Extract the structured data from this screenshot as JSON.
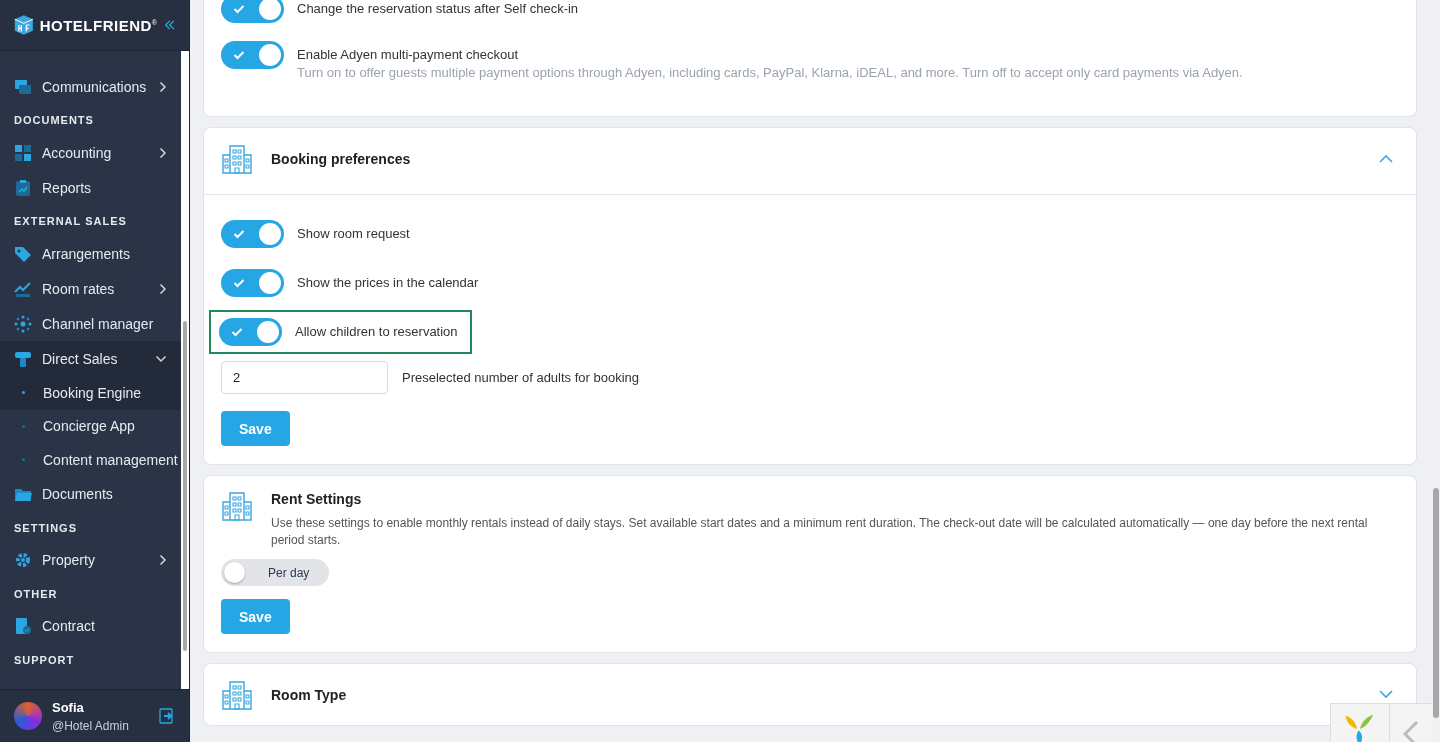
{
  "sidebar": {
    "brand": "HOTELFRIEND",
    "brand_mark": "®",
    "items": [
      {
        "kind": "item",
        "label": "Communications",
        "has_submenu": true,
        "expanded": false,
        "selected": false
      },
      {
        "kind": "heading",
        "label": "DOCUMENTS"
      },
      {
        "kind": "item",
        "label": "Accounting",
        "has_submenu": true,
        "expanded": false,
        "selected": false
      },
      {
        "kind": "item",
        "label": "Reports",
        "has_submenu": false,
        "selected": false
      },
      {
        "kind": "heading",
        "label": "EXTERNAL SALES"
      },
      {
        "kind": "item",
        "label": "Arrangements",
        "has_submenu": false,
        "selected": false
      },
      {
        "kind": "item",
        "label": "Room rates",
        "has_submenu": true,
        "expanded": false,
        "selected": false
      },
      {
        "kind": "item",
        "label": "Channel manager",
        "has_submenu": false,
        "selected": false
      },
      {
        "kind": "item",
        "label": "Direct Sales",
        "has_submenu": true,
        "expanded": true,
        "selected": false,
        "children": [
          {
            "label": "Booking Engine",
            "selected": true
          },
          {
            "label": "Concierge App",
            "selected": false
          },
          {
            "label": "Content management",
            "selected": false
          }
        ]
      },
      {
        "kind": "item",
        "label": "Documents",
        "has_submenu": false,
        "selected": false
      },
      {
        "kind": "heading",
        "label": "SETTINGS"
      },
      {
        "kind": "item",
        "label": "Property",
        "has_submenu": true,
        "expanded": false,
        "selected": false
      },
      {
        "kind": "heading",
        "label": "OTHER"
      },
      {
        "kind": "item",
        "label": "Contract",
        "has_submenu": false,
        "selected": false
      },
      {
        "kind": "heading",
        "label": "SUPPORT"
      }
    ],
    "user": {
      "name": "Sofia",
      "role": "@Hotel Admin"
    }
  },
  "cards": [
    {
      "kind": "toggles",
      "toggles": [
        {
          "label": "Change the reservation status after Self check-in",
          "on": true,
          "highlighted": false
        },
        {
          "label": "Enable Adyen multi-payment checkout",
          "description": "Turn on to offer guests multiple payment options through Adyen, including cards, PayPal, Klarna, iDEAL, and more. Turn off to accept only card payments via Adyen.",
          "on": true,
          "highlighted": false
        }
      ]
    },
    {
      "kind": "section",
      "title": "Booking preferences",
      "expanded": true,
      "toggles": [
        {
          "label": "Show room request",
          "on": true,
          "highlighted": false
        },
        {
          "label": "Show the prices in the calendar",
          "on": true,
          "highlighted": false
        },
        {
          "label": "Allow children to reservation",
          "on": true,
          "highlighted": true
        }
      ],
      "field": {
        "value": "2",
        "label": "Preselected number of adults for booking"
      },
      "button": "Save"
    },
    {
      "kind": "section",
      "title": "Rent Settings",
      "description": "Use these settings to enable monthly rentals instead of daily stays. Set available start dates and a minimum rent duration. The check-out date will be calculated automatically — one day before the next rental period starts.",
      "switch": {
        "label": "Per day",
        "on": false
      },
      "button": "Save"
    },
    {
      "kind": "section",
      "title": "Room Type",
      "expanded": false
    }
  ]
}
